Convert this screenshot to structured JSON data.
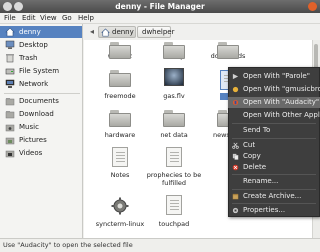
{
  "window": {
    "title": "denny - File Manager"
  },
  "menubar": [
    "File",
    "Edit",
    "View",
    "Go",
    "Help"
  ],
  "sidebar": {
    "items": [
      {
        "label": "denny",
        "icon": "home-icon",
        "selected": true
      },
      {
        "label": "Desktop",
        "icon": "desktop-icon"
      },
      {
        "label": "Trash",
        "icon": "trash-icon"
      },
      {
        "label": "File System",
        "icon": "drive-icon"
      },
      {
        "label": "Network",
        "icon": "network-icon"
      },
      {
        "label": "Documents",
        "icon": "folder-icon"
      },
      {
        "label": "Download",
        "icon": "folder-icon"
      },
      {
        "label": "Music",
        "icon": "music-icon"
      },
      {
        "label": "Pictures",
        "icon": "pictures-icon"
      },
      {
        "label": "Videos",
        "icon": "videos-icon"
      }
    ]
  },
  "pathbar": {
    "crumbs": [
      "denny",
      "dwhelper"
    ]
  },
  "files": [
    {
      "name": "wt2012",
      "kind": "folder"
    },
    {
      "name": "denny",
      "kind": "folder"
    },
    {
      "name": "downloads",
      "kind": "folder"
    },
    {
      "name": "freemode",
      "kind": "folder"
    },
    {
      "name": "gas.flv",
      "kind": "video-thumb"
    },
    {
      "name": "",
      "kind": "selected-file"
    },
    {
      "name": "hardware",
      "kind": "folder"
    },
    {
      "name": "net data",
      "kind": "folder"
    },
    {
      "name": "news",
      "kind": "folder"
    },
    {
      "name": "Notes",
      "kind": "document"
    },
    {
      "name": "prophecies to be fulfilled",
      "kind": "document"
    },
    {
      "name": "syncterm-linux",
      "kind": "gear-file"
    },
    {
      "name": "touchpad",
      "kind": "document"
    }
  ],
  "context_menu": {
    "items": [
      {
        "label": "Open With \"Parole\"",
        "icon": "parole-icon"
      },
      {
        "label": "Open With \"gmusicbrows",
        "icon": "music-app-icon"
      },
      {
        "label": "Open With \"Audacity\"",
        "icon": "audacity-icon",
        "highlighted": true
      },
      {
        "label": "Open With Other Applicati",
        "icon": ""
      },
      {
        "label": "Send To",
        "icon": ""
      },
      {
        "label": "Cut",
        "icon": "cut-icon"
      },
      {
        "label": "Copy",
        "icon": "copy-icon"
      },
      {
        "label": "Delete",
        "icon": "delete-icon"
      },
      {
        "label": "Rename...",
        "icon": ""
      },
      {
        "label": "Create Archive...",
        "icon": "archive-icon"
      },
      {
        "label": "Properties...",
        "icon": "properties-icon"
      }
    ]
  },
  "status": {
    "text": "Use \"Audacity\" to open the selected file"
  },
  "colors": {
    "selection": "#5682c0",
    "menu_bg": "#3e3e3e",
    "titlebar": "#4a4a4a"
  }
}
